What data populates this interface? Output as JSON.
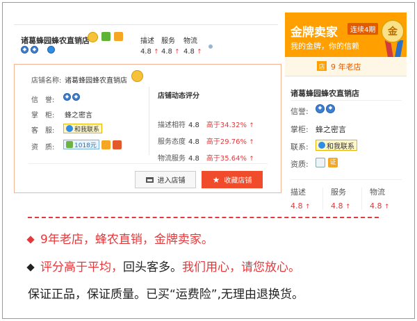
{
  "shop": {
    "name": "诸葛蜂园蜂农直销店",
    "wangwang_label": "和我联系",
    "keeper": "蜂之密言",
    "deposit": "1018元"
  },
  "header": {
    "cols": [
      {
        "label": "描述",
        "score": "4.8"
      },
      {
        "label": "服务",
        "score": "4.8"
      },
      {
        "label": "物流",
        "score": "4.8"
      }
    ],
    "arrow": "↑"
  },
  "card": {
    "name_label": "店铺名称:",
    "rep_label": "信　誉:",
    "keeper_label": "掌　柜:",
    "service_label": "客　服:",
    "qual_label": "资　质:",
    "dsr_title": "店铺动态评分",
    "dsr": [
      {
        "label": "描述相符",
        "score": "4.8",
        "compare": "高于34.32%"
      },
      {
        "label": "服务态度",
        "score": "4.8",
        "compare": "高于29.76%"
      },
      {
        "label": "物流服务",
        "score": "4.8",
        "compare": "高于35.64%"
      }
    ],
    "enter_label": "进入店铺",
    "fav_label": "收藏店铺"
  },
  "gold_panel": {
    "title": "金牌卖家",
    "tag": "连续4期",
    "subtitle": "我的金牌，你的信赖",
    "medal_char": "金",
    "years_icon": "店",
    "years_text": "9 年老店",
    "rep_label": "信誉:",
    "keeper_label": "掌柜:",
    "contact_label": "联系:",
    "qual_label": "资质:",
    "qual_badge": "证"
  },
  "promo": {
    "line1": "9年老店，蜂农直销，金牌卖家。",
    "line2_a": "评分高于平均，",
    "line2_b": "回头客多。",
    "line2_c": "我们用心，请您放心。",
    "line3": "保证正品，保证质量。已买“运费险”,无理由退换货。"
  },
  "colors": {
    "accent_red": "#e4393c",
    "gold": "#ffa000",
    "fav_button": "#f04b2a"
  }
}
